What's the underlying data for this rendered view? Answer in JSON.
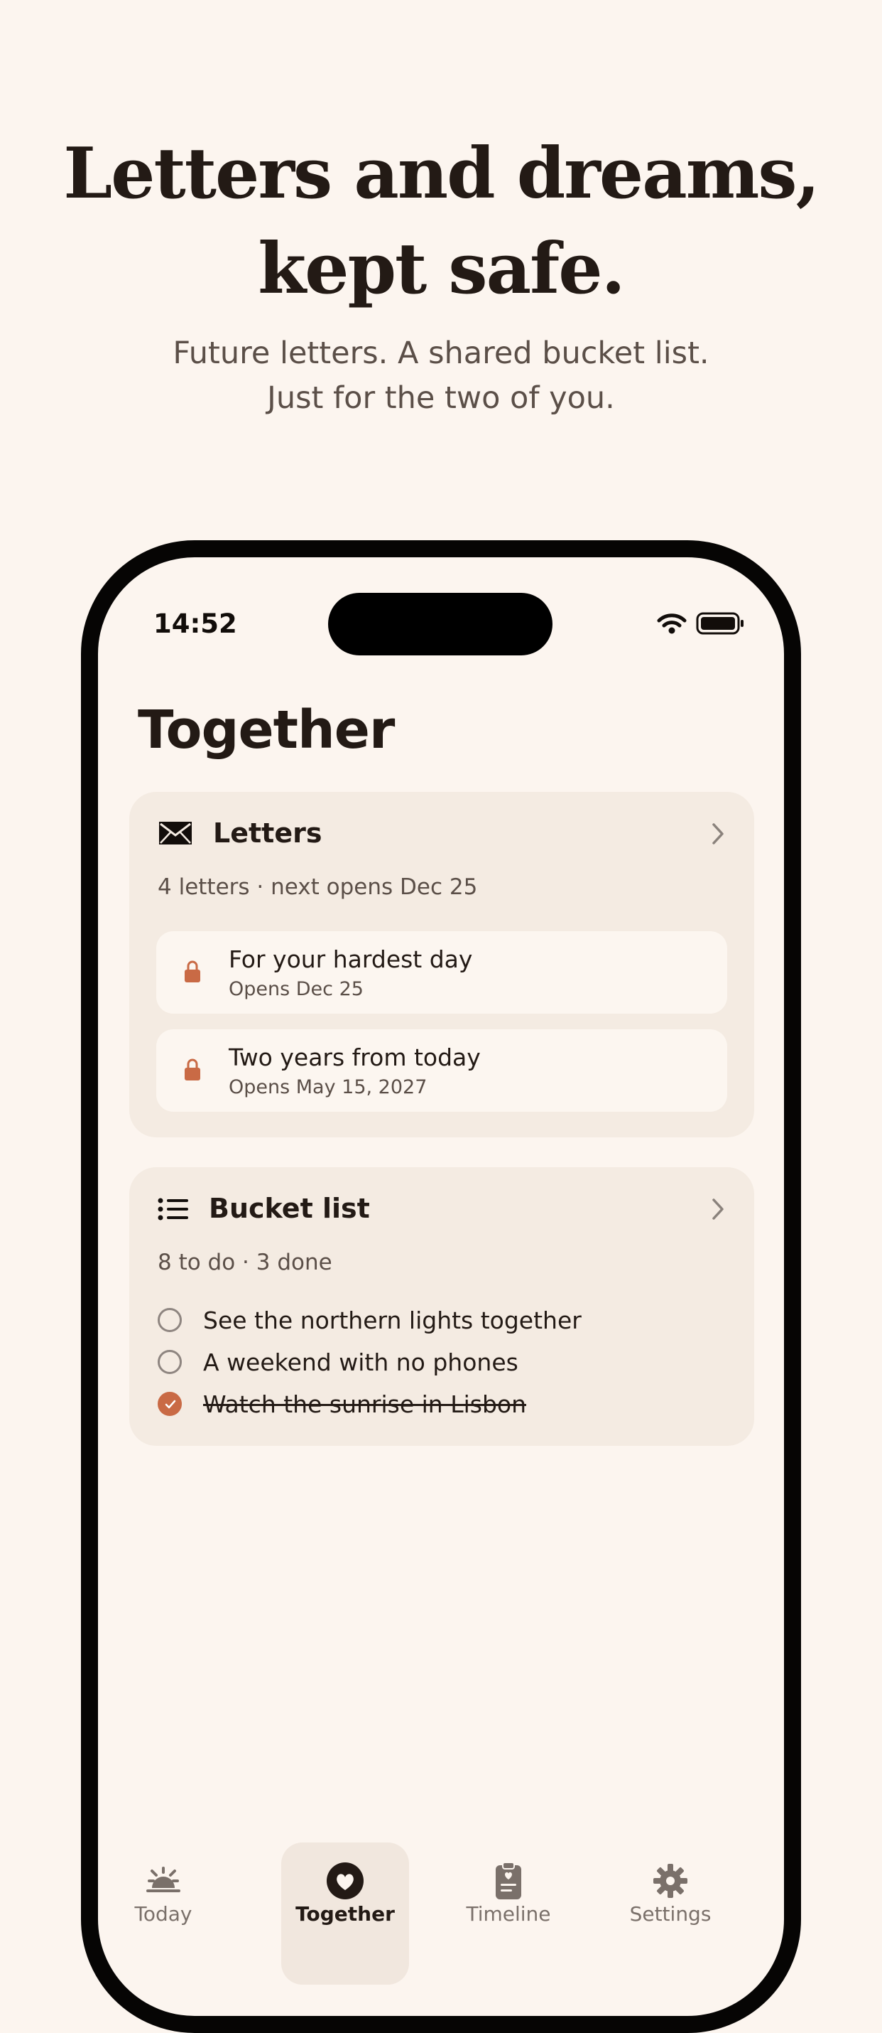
{
  "hero": {
    "title_line1": "Letters and dreams,",
    "title_line2": "kept safe.",
    "subtitle_line1": "Future letters. A shared bucket list.",
    "subtitle_line2": "Just for the two of you."
  },
  "status_bar": {
    "time": "14:52",
    "icons": [
      "wifi-icon",
      "battery-icon"
    ]
  },
  "screen": {
    "title": "Together"
  },
  "letters_card": {
    "title": "Letters",
    "icon": "envelope-icon",
    "meta": "4 letters · next opens Dec 25",
    "items": [
      {
        "title": "For your hardest day",
        "subtitle": "Opens Dec 25",
        "icon": "lock-icon"
      },
      {
        "title": "Two years from today",
        "subtitle": "Opens May 15, 2027",
        "icon": "lock-icon"
      }
    ]
  },
  "bucket_card": {
    "title": "Bucket list",
    "icon": "list-icon",
    "meta": "8 to do · 3 done",
    "items": [
      {
        "label": "See the northern lights together",
        "done": false
      },
      {
        "label": "A weekend with no phones",
        "done": false
      },
      {
        "label": "Watch the sunrise in Lisbon",
        "done": true
      }
    ]
  },
  "tab_bar": {
    "tabs": [
      {
        "label": "Today",
        "icon": "sunrise-icon",
        "active": false
      },
      {
        "label": "Together",
        "icon": "heart-icon",
        "active": true
      },
      {
        "label": "Timeline",
        "icon": "clipboard-icon",
        "active": false
      },
      {
        "label": "Settings",
        "icon": "gear-icon",
        "active": false
      }
    ]
  },
  "colors": {
    "background": "#fcf5ef",
    "card": "#f4ebe2",
    "accent": "#c96a45",
    "text_primary": "#231a15",
    "text_secondary": "#5b4f48",
    "phone_frame": "#060504"
  }
}
